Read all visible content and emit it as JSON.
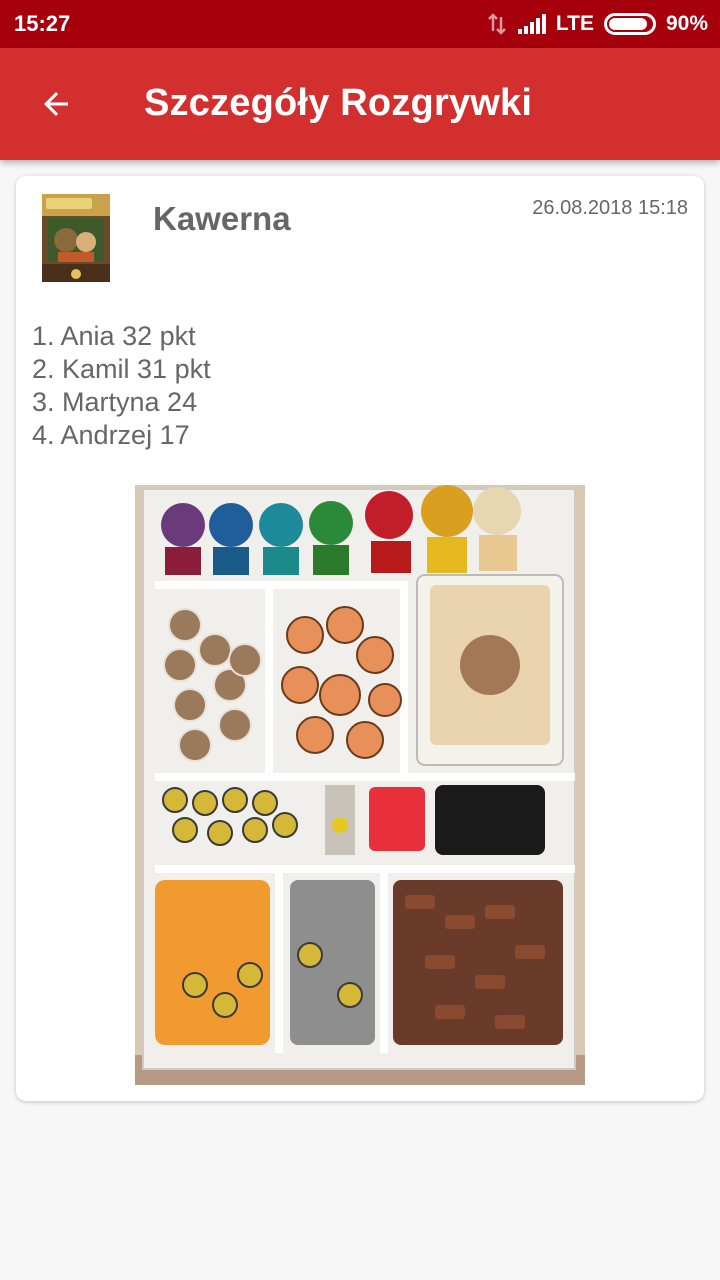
{
  "status_bar": {
    "time": "15:27",
    "network": "LTE",
    "battery": "90%",
    "battery_level": 0.9
  },
  "app_bar": {
    "title": "Szczegóły Rozgrywki",
    "back_icon": "arrow-back-icon"
  },
  "session": {
    "game_name": "Kawerna",
    "date": "26.08.2018 15:18",
    "results": [
      "1. Ania 32 pkt",
      "2. Kamil 31 pkt",
      "3. Martyna 24",
      "4. Andrzej 17"
    ]
  },
  "colors": {
    "status_bar": "#a5000c",
    "app_bar": "#d32f2f",
    "text_gray": "#666666"
  }
}
